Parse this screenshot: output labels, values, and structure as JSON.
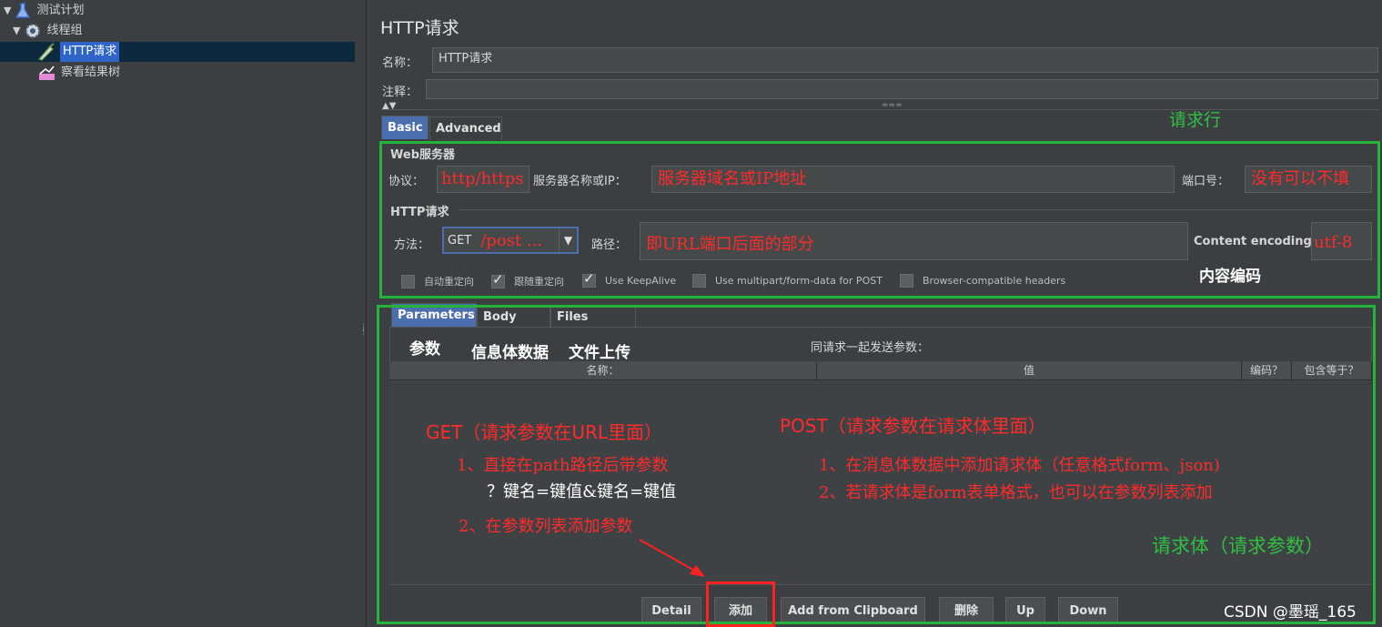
{
  "tree": {
    "items": [
      {
        "label": "测试计划",
        "icon": "flask-icon"
      },
      {
        "label": "线程组",
        "icon": "gear-icon"
      },
      {
        "label": "HTTP请求",
        "icon": "pipette-icon"
      },
      {
        "label": "察看结果树",
        "icon": "chart-icon"
      }
    ]
  },
  "panel": {
    "title": "HTTP请求",
    "name_label": "名称：",
    "name_value": "HTTP请求",
    "comment_label": "注释：",
    "comment_value": ""
  },
  "config_tabs": [
    {
      "label": "Basic",
      "active": true
    },
    {
      "label": "Advanced",
      "active": false
    }
  ],
  "web_server": {
    "legend": "Web服务器",
    "protocol_label": "协议：",
    "protocol_value": "http/https",
    "server_label": "服务器名称或IP：",
    "server_value": "服务器域名或IP地址",
    "port_label": "端口号：",
    "port_value": "没有可以不填"
  },
  "http_request": {
    "legend": "HTTP请求",
    "method_label": "方法：",
    "method_value": "GET",
    "method_note": "/post ...",
    "path_label": "路径：",
    "path_value": "即URL端口后面的部分",
    "encoding_label": "Content encoding:",
    "encoding_value": "utf-8",
    "checkboxes": [
      {
        "label": "自动重定向",
        "checked": false
      },
      {
        "label": "跟随重定向",
        "checked": true
      },
      {
        "label": "Use KeepAlive",
        "checked": true
      },
      {
        "label": "Use multipart/form-data for POST",
        "checked": false
      },
      {
        "label": "Browser-compatible headers",
        "checked": false
      }
    ]
  },
  "param_tabs": [
    {
      "label": "Parameters",
      "active": true
    },
    {
      "label": "Body Data",
      "active": false
    },
    {
      "label": "Files Upload",
      "active": false
    }
  ],
  "params": {
    "send_label": "同请求一起发送参数：",
    "columns": [
      "名称：",
      "值",
      "编码？",
      "包含等于？"
    ]
  },
  "buttons": [
    "Detail",
    "添加",
    "Add from Clipboard",
    "删除",
    "Up",
    "Down"
  ],
  "annotations": {
    "request_line": "请求行",
    "content_encoding": "内容编码",
    "param_tab": "参数",
    "body_tab": "信息体数据",
    "files_tab": "文件上传",
    "get_title": "GET（请求参数在URL里面）",
    "get_1": "1、直接在path路径后带参数",
    "get_1b": "？键名=键值&键名=键值",
    "get_2": "2、在参数列表添加参数",
    "post_title": "POST（请求参数在请求体里面）",
    "post_1": "1、在消息体数据中添加请求体（任意格式form、json)",
    "post_2": "2、若请求体是form表单格式，也可以在参数列表添加",
    "request_body": "请求体（请求参数）",
    "watermark": "CSDN @墨瑶_165"
  },
  "colors": {
    "annotation_green": "#26b33a",
    "annotation_red": "#ff2a2a",
    "selection_blue": "#2f65ca"
  }
}
